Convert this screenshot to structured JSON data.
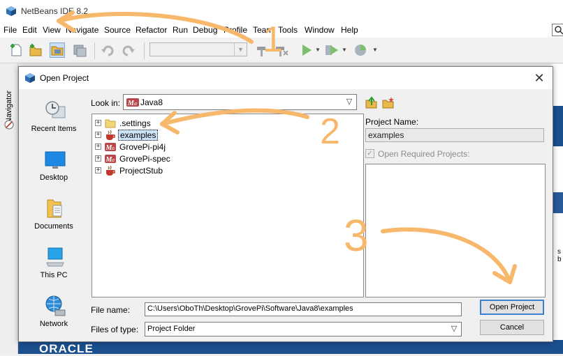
{
  "ide": {
    "title": "NetBeans IDE 8.2",
    "menu": [
      "File",
      "Edit",
      "View",
      "Navigate",
      "Source",
      "Refactor",
      "Run",
      "Debug",
      "Profile",
      "Team",
      "Tools",
      "Window",
      "Help"
    ],
    "navigator_label": "Navigator",
    "right_snippet": "s b",
    "oracle_text": "ORACLE"
  },
  "dialog": {
    "title": "Open Project",
    "places": [
      "Recent Items",
      "Desktop",
      "Documents",
      "This PC",
      "Network"
    ],
    "look_in_label": "Look in:",
    "look_in_value": "Java8",
    "tree": [
      {
        "label": ".settings",
        "icon": "folder-icon",
        "selected": false
      },
      {
        "label": "examples",
        "icon": "coffee-cup-project-icon",
        "selected": true
      },
      {
        "label": "GrovePi-pi4j",
        "icon": "maven-project-icon",
        "selected": false
      },
      {
        "label": "GrovePi-spec",
        "icon": "maven-project-icon",
        "selected": false
      },
      {
        "label": "ProjectStub",
        "icon": "coffee-cup-project-icon",
        "selected": false
      }
    ],
    "project_name_label": "Project Name:",
    "project_name_value": "examples",
    "open_required_label": "Open Required Projects:",
    "file_name_label": "File name:",
    "file_name_value": "C:\\Users\\OboTh\\Desktop\\GrovePi\\Software\\Java8\\examples",
    "files_of_type_label": "Files of type:",
    "files_of_type_value": "Project Folder",
    "open_button": "Open Project",
    "cancel_button": "Cancel"
  },
  "annotations": [
    "1",
    "2",
    "3"
  ],
  "colors": {
    "annotation": "#f8b86b",
    "selection": "#cde3f8",
    "default_button_border": "#3c7fd1",
    "oracle_blue": "#1c4f8e"
  }
}
